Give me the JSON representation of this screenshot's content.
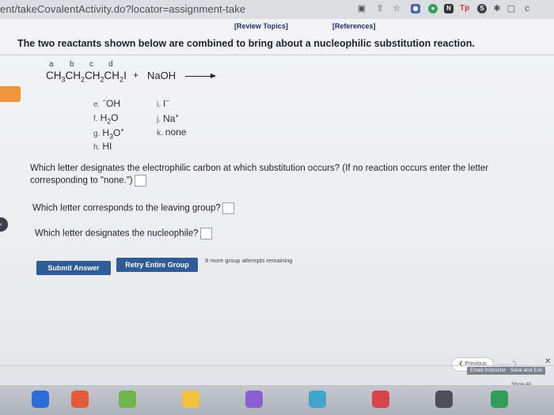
{
  "browser": {
    "url": "ent/takeCovalentActivity.do?locator=assignment-take",
    "icons": [
      "extension-icon",
      "share-icon",
      "star-icon",
      "profile-icon",
      "chrome-icon",
      "ext-n-icon",
      "ext-tp-icon",
      "ext-s-icon",
      "puzzle-icon",
      "window-icon",
      "menu-c-icon"
    ],
    "tp_label": "Tp",
    "s_label": "S",
    "c_label": "c"
  },
  "header": {
    "review_topics": "[Review Topics]",
    "references": "[References]"
  },
  "question": {
    "title": "The two reactants shown below are combined to bring about a nucleophilic substitution reaction.",
    "atom_letters": [
      "a",
      "b",
      "c",
      "d"
    ],
    "reactant": "CH3CH2CH2CH2I",
    "plus": "+",
    "reagent": "NaOH"
  },
  "options": [
    {
      "letter": "e.",
      "text": "⁻OH"
    },
    {
      "letter": "f.",
      "text": "H2O"
    },
    {
      "letter": "g.",
      "text": "H3O⁺"
    },
    {
      "letter": "h.",
      "text": "HI"
    },
    {
      "letter": "i.",
      "text": "I⁻"
    },
    {
      "letter": "j.",
      "text": "Na⁺"
    },
    {
      "letter": "k.",
      "text": "none"
    }
  ],
  "prompts": {
    "q1_line1": "Which letter designates the electrophilic carbon at which substitution occurs? (If no reaction occurs enter the letter",
    "q1_line2": "corresponding to \"none.\")",
    "q1_value": "",
    "q2": "Which letter corresponds to the leaving group?",
    "q2_value": "",
    "q3": "Which letter designates the nucleophile?",
    "q3_value": ""
  },
  "actions": {
    "submit": "Submit Answer",
    "retry": "Retry Entire Group",
    "remaining": "9 more group attempts remaining"
  },
  "navigation": {
    "previous": "Previous",
    "next": "Next",
    "email_instructor": "Email Instructor",
    "save_and_exit": "Save and Exit",
    "show_all": "Show All"
  },
  "colors": {
    "accent_button": "#2f5b97",
    "orange_tab": "#f0953c",
    "links": "#1a2f6d"
  }
}
